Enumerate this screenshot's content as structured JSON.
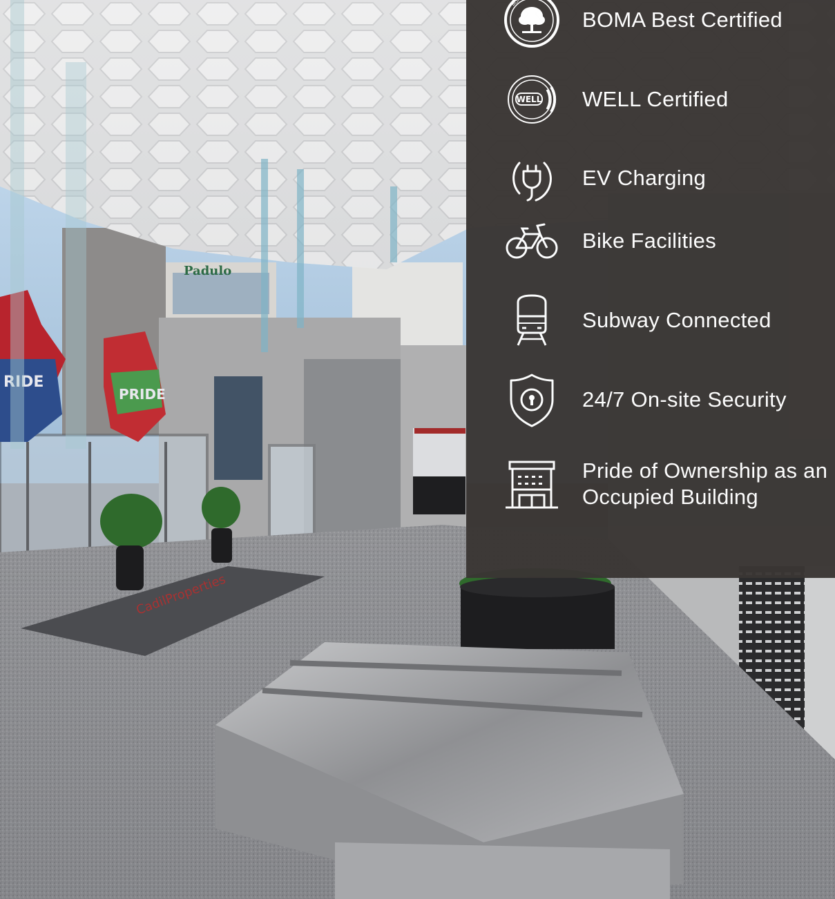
{
  "colors": {
    "panel_bg": "#3a3634",
    "text": "#ffffff",
    "icon": "#ffffff"
  },
  "features": [
    {
      "icon": "boma-best-seal-icon",
      "label": "BOMA Best Certified",
      "seal_text": "BOMA BEST"
    },
    {
      "icon": "well-seal-icon",
      "label": "WELL Certified",
      "seal_text": "WELL"
    },
    {
      "icon": "ev-plug-icon",
      "label": "EV Charging"
    },
    {
      "icon": "bicycle-icon",
      "label": "Bike Facilities"
    },
    {
      "icon": "train-icon",
      "label": "Subway Connected"
    },
    {
      "icon": "shield-keyhole-icon",
      "label": "24/7 On-site Security"
    },
    {
      "icon": "office-building-icon",
      "label_lines": [
        "Pride of Ownership as an",
        "Occupied Building"
      ]
    }
  ],
  "photo": {
    "description_icon": "lobby-photo",
    "signs": [
      "Padulo",
      "PRIDE",
      "PRIDE"
    ]
  }
}
